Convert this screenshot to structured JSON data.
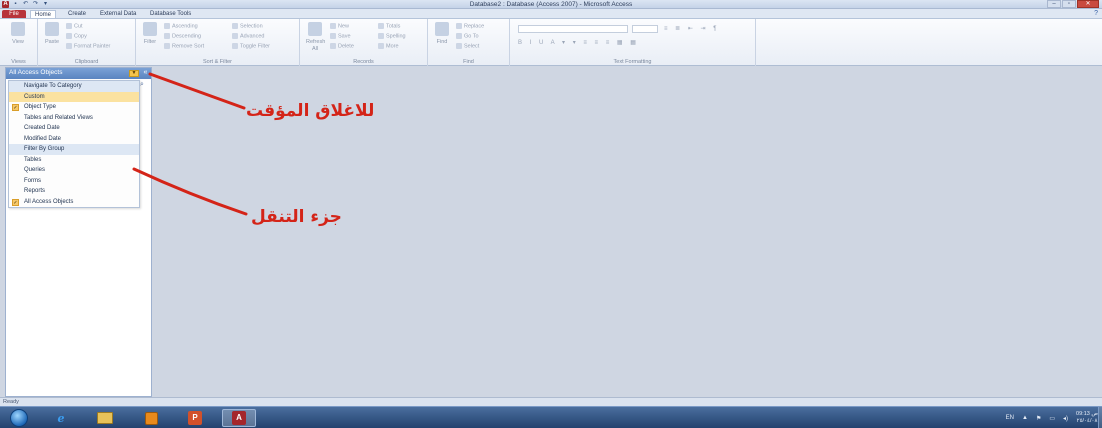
{
  "window": {
    "title": "Database2 : Database (Access 2007) - Microsoft Access",
    "qat_icons": [
      "access-app-icon",
      "save-icon",
      "undo-icon",
      "redo-icon",
      "customize-icon"
    ],
    "app_icon_letter": "A"
  },
  "tabs": {
    "file": "File",
    "home": "Home",
    "create": "Create",
    "external": "External Data",
    "dbtools": "Database Tools"
  },
  "ribbon": {
    "views": {
      "view": "View",
      "group": "Views"
    },
    "clipboard": {
      "paste": "Paste",
      "cut": "Cut",
      "copy": "Copy",
      "format_painter": "Format Painter",
      "group": "Clipboard"
    },
    "sort": {
      "filter": "Filter",
      "ascending": "Ascending",
      "descending": "Descending",
      "remove_sort": "Remove Sort",
      "selection": "Selection",
      "advanced": "Advanced",
      "toggle_filter": "Toggle Filter",
      "group": "Sort & Filter"
    },
    "records": {
      "refresh": "Refresh All",
      "new": "New",
      "save": "Save",
      "delete": "Delete",
      "totals": "Totals",
      "spelling": "Spelling",
      "more": "More",
      "group": "Records"
    },
    "find": {
      "find": "Find",
      "replace": "Replace",
      "goto": "Go To",
      "select": "Select",
      "group": "Find"
    },
    "text": {
      "group": "Text Formatting"
    }
  },
  "nav": {
    "header": "All Access Objects",
    "items": [
      {
        "label": "Navigate To Category",
        "kind": "section"
      },
      {
        "label": "Custom",
        "kind": "selected"
      },
      {
        "label": "Object Type",
        "kind": "checked"
      },
      {
        "label": "Tables and Related Views",
        "kind": "normal"
      },
      {
        "label": "Created Date",
        "kind": "normal"
      },
      {
        "label": "Modified Date",
        "kind": "normal"
      },
      {
        "label": "Filter By Group",
        "kind": "section"
      },
      {
        "label": "Tables",
        "kind": "normal"
      },
      {
        "label": "Queries",
        "kind": "normal"
      },
      {
        "label": "Forms",
        "kind": "normal"
      },
      {
        "label": "Reports",
        "kind": "normal"
      },
      {
        "label": "All Access Objects",
        "kind": "checked"
      }
    ]
  },
  "annotations": {
    "close_label": "للاغلاق المؤقت",
    "nav_label": "جزء التنقل",
    "color": "#d42418"
  },
  "status": {
    "text": "Ready"
  },
  "taskbar": {
    "apps": [
      "start-orb",
      "internet-explorer",
      "windows-explorer",
      "media-player",
      "powerpoint",
      "access"
    ],
    "ppt_letter": "P",
    "access_letter": "A",
    "ie_letter": "e",
    "tray_lang": "EN",
    "clock_time": "09:13 ص",
    "clock_date": "٢٥/٠٤/٠٨"
  }
}
